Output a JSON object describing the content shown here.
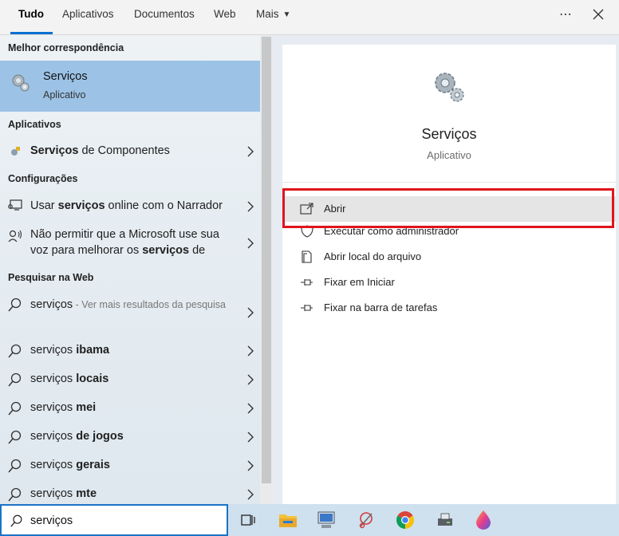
{
  "tabs": [
    {
      "label": "Tudo",
      "active": true
    },
    {
      "label": "Aplicativos"
    },
    {
      "label": "Documentos"
    },
    {
      "label": "Web"
    },
    {
      "label": "Mais"
    }
  ],
  "topbar_icons": [
    "more-options-icon",
    "close-icon"
  ],
  "left": {
    "best_match_header": "Melhor correspondência",
    "best_match": {
      "title": "Serviços",
      "subtitle": "Aplicativo",
      "icon": "gears-icon"
    },
    "apps_header": "Aplicativos",
    "apps": [
      {
        "bold": "Serviços",
        "rest": " de Componentes",
        "icon": "component-services-icon"
      }
    ],
    "settings_header": "Configurações",
    "settings": [
      {
        "pre": "Usar ",
        "bold": "serviços",
        "rest": " online com o Narrador",
        "icon": "narrator-monitor-icon"
      },
      {
        "pre": "Não permitir que a Microsoft use sua voz para melhorar os ",
        "bold": "serviços",
        "rest": " de",
        "icon": "voice-icon"
      }
    ],
    "web_header": "Pesquisar na Web",
    "web": [
      {
        "query": "serviços",
        "suffix": "",
        "extra": " - Ver mais resultados da pesquisa"
      },
      {
        "query": "serviços ",
        "suffix": "ibama"
      },
      {
        "query": "serviços ",
        "suffix": "locais"
      },
      {
        "query": "serviços ",
        "suffix": "mei"
      },
      {
        "query": "serviços ",
        "suffix": "de jogos"
      },
      {
        "query": "serviços ",
        "suffix": "gerais"
      },
      {
        "query": "serviços ",
        "suffix": "mte"
      }
    ]
  },
  "right": {
    "title": "Serviços",
    "subtitle": "Aplicativo",
    "actions": [
      {
        "label": "Abrir",
        "icon": "open-icon"
      },
      {
        "label": "Executar como administrador",
        "icon": "shield-icon"
      },
      {
        "label": "Abrir local do arquivo",
        "icon": "file-location-icon"
      },
      {
        "label": "Fixar em Iniciar",
        "icon": "pin-icon"
      },
      {
        "label": "Fixar na barra de tarefas",
        "icon": "pin-taskbar-icon"
      }
    ]
  },
  "search": {
    "value": "serviços"
  },
  "taskbar_apps": [
    "task-view-icon",
    "file-explorer-icon",
    "network-app-icon",
    "snipping-icon",
    "chrome-icon",
    "printer-app-icon",
    "paint-drop-icon"
  ]
}
